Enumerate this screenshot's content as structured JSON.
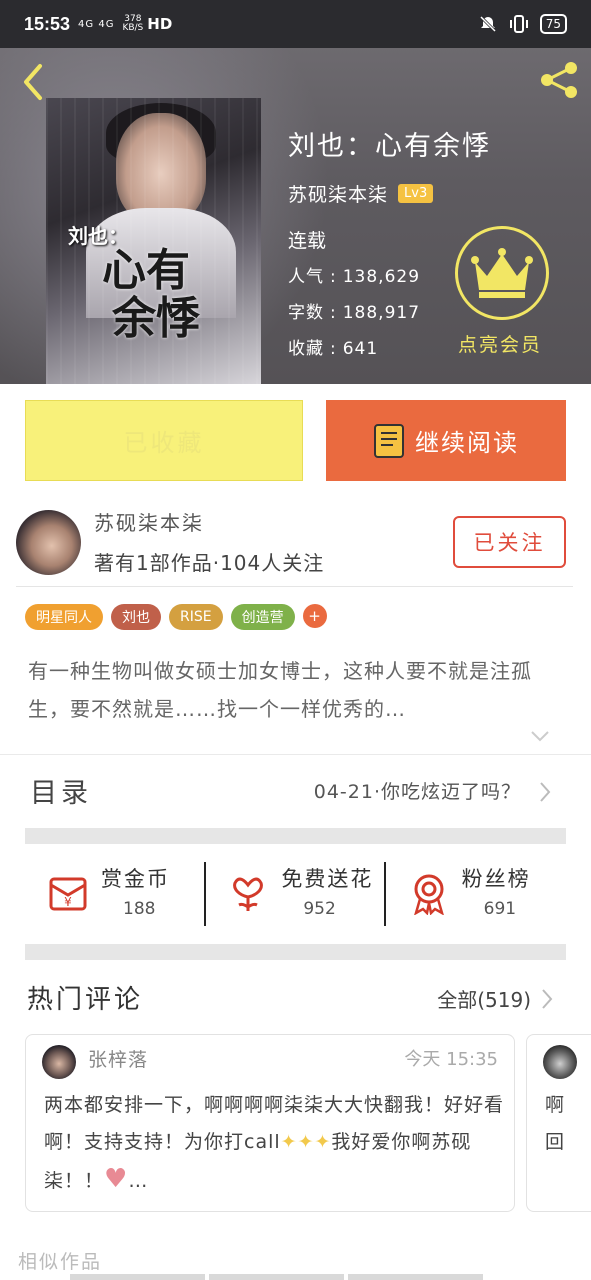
{
  "status_bar": {
    "time": "15:53",
    "signal": "4G 4G",
    "speed_value": "378",
    "speed_unit": "KB/S",
    "hd": "HD",
    "battery": "75"
  },
  "book": {
    "title": "刘也：心有余悸",
    "author": "苏砚柒本柒",
    "level": "Lv3",
    "status": "连载",
    "cover_text_1": "刘也：",
    "cover_text_2": "心有",
    "cover_text_3": "余悸",
    "stats": [
      {
        "label": "人气",
        "value": "138,629"
      },
      {
        "label": "字数",
        "value": "188,917"
      },
      {
        "label": "收藏",
        "value": "641"
      }
    ],
    "vip_label": "点亮会员"
  },
  "actions": {
    "favorited_label": "已收藏",
    "continue_label": "继续阅读"
  },
  "author_card": {
    "name": "苏砚柒本柒",
    "meta": "著有1部作品·104人关注",
    "follow_label": "已关注"
  },
  "tags": [
    {
      "label": "明星同人",
      "color": "#f0a030"
    },
    {
      "label": "刘也",
      "color": "#c0604a"
    },
    {
      "label": "RISE",
      "color": "#d4a040"
    },
    {
      "label": "创造营",
      "color": "#7fb14a"
    }
  ],
  "tag_add": "+",
  "synopsis": "有一种生物叫做女硕士加女博士，这种人要不就是注孤生，要不然就是……找一个一样优秀的…",
  "catalog": {
    "label": "目录",
    "latest": "04-21·你吃炫迈了吗？"
  },
  "interactions": [
    {
      "name": "赏金币",
      "value": "188"
    },
    {
      "name": "免费送花",
      "value": "952"
    },
    {
      "name": "粉丝榜",
      "value": "691"
    }
  ],
  "comments": {
    "header": "热门评论",
    "all_label": "全部(519)",
    "items": [
      {
        "user": "张梓落",
        "time": "今天 15:35",
        "text_1": "两本都安排一下，啊啊啊啊柒柒大大快翻我！好好看啊！支持支持！为你打call",
        "text_2": "我好爱你啊苏砚柒！！",
        "ellipsis": "…"
      },
      {
        "user": "",
        "text_1": "啊",
        "text_2": "回"
      }
    ]
  },
  "similar_label": "相似作品",
  "colors": {
    "accent_orange": "#ea6a3f",
    "fav_yellow": "#f8f17a",
    "vip_yellow": "#f2e664",
    "follow_red": "#e04c3c"
  }
}
